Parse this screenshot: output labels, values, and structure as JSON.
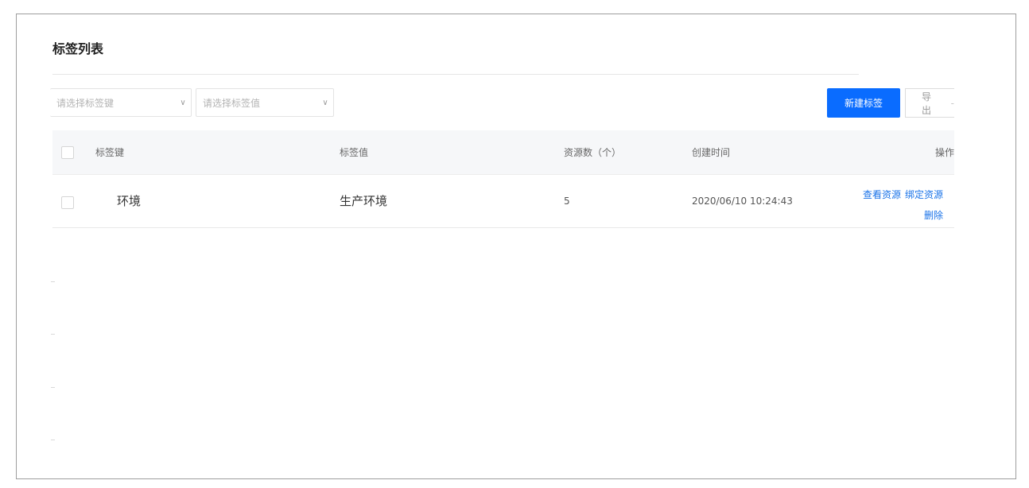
{
  "page": {
    "title": "标签列表"
  },
  "filters": {
    "key_placeholder": "请选择标签键",
    "value_placeholder": "请选择标签值"
  },
  "toolbar": {
    "new_label": "新建标签",
    "export_label": "导出"
  },
  "table": {
    "headers": {
      "key": "标签键",
      "value": "标签值",
      "count": "资源数（个）",
      "created": "创建时间",
      "actions": "操作"
    },
    "rows": [
      {
        "key": "环境",
        "value": "生产环境",
        "count": "5",
        "created": "2020/06/10 10:24:43",
        "actions": {
          "view": "查看资源",
          "bind": "绑定资源",
          "delete": "删除"
        }
      }
    ]
  },
  "colors": {
    "primary": "#0a6cff",
    "link": "#1a73e8",
    "header_bg": "#f6f7f9"
  },
  "icons": {
    "select_arrow": "chevron-down-icon"
  }
}
